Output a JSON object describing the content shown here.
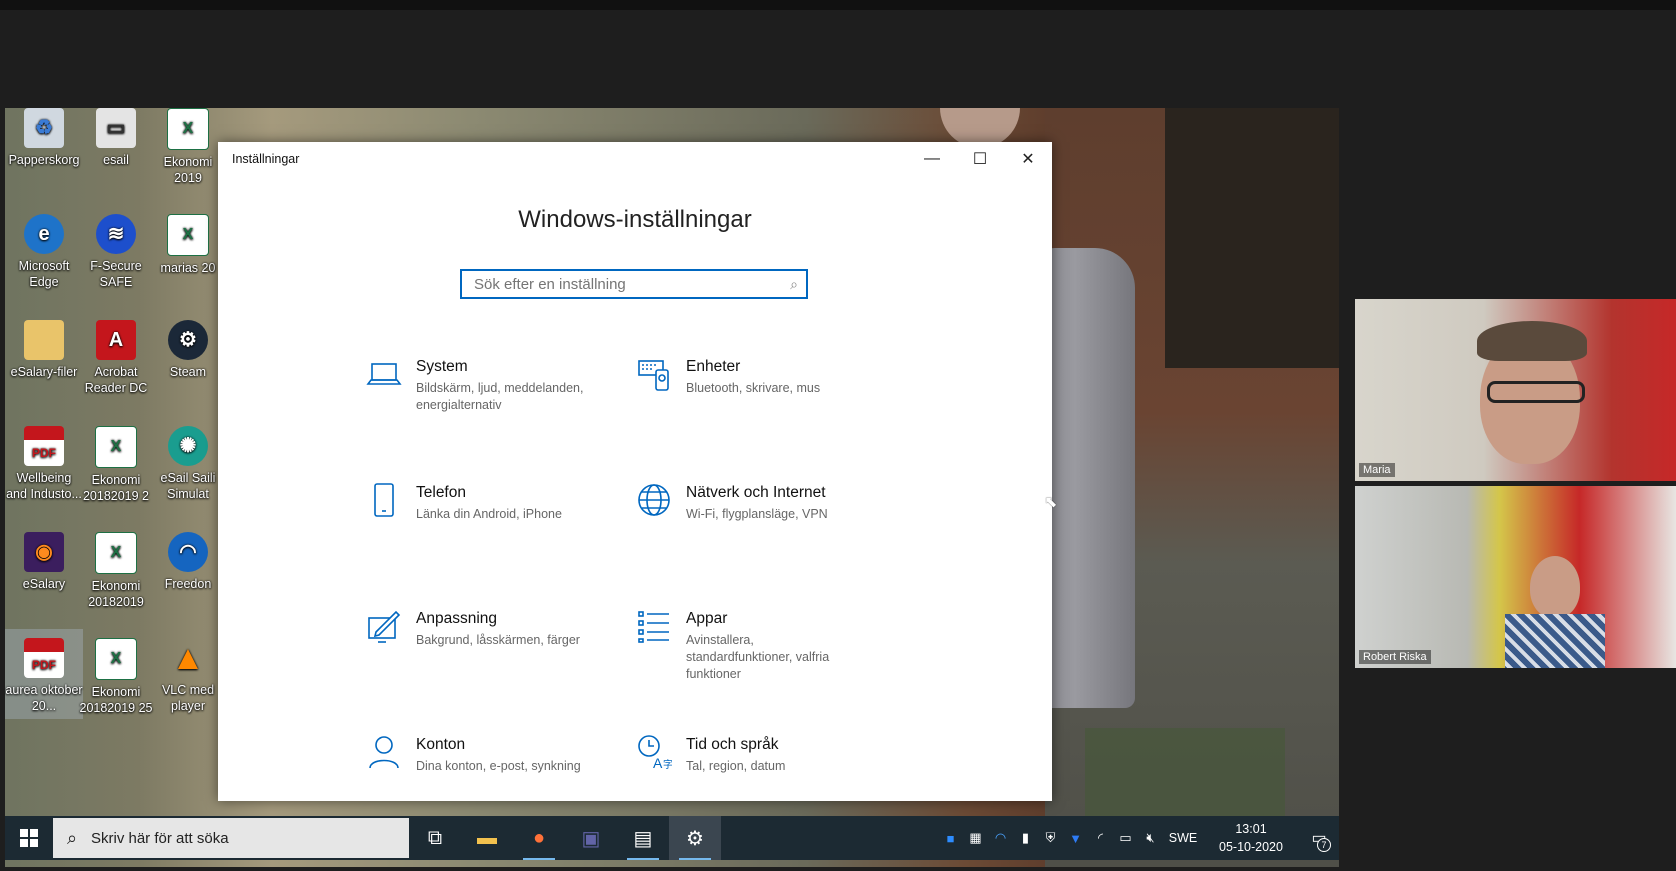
{
  "desktop_icons": [
    {
      "name": "recycle-bin-icon",
      "label": "Papperskorg",
      "glyph": "♻",
      "cls": "g-bin"
    },
    {
      "name": "esail-shortcut-icon",
      "label": "esail",
      "glyph": "▭",
      "cls": "g-pc"
    },
    {
      "name": "excel-file-icon",
      "label": "Ekonomi 2019",
      "glyph": "X",
      "cls": "g-xls"
    },
    {
      "name": "edge-icon",
      "label": "Microsoft Edge",
      "glyph": "e",
      "cls": "g-edge"
    },
    {
      "name": "fsecure-icon",
      "label": "F-Secure SAFE",
      "glyph": "≋",
      "cls": "g-fsec"
    },
    {
      "name": "excel-file-icon",
      "label": "marias 20",
      "glyph": "X",
      "cls": "g-xls"
    },
    {
      "name": "folder-icon",
      "label": "eSalary-filer",
      "glyph": "",
      "cls": "g-folder"
    },
    {
      "name": "acrobat-icon",
      "label": "Acrobat Reader DC",
      "glyph": "A",
      "cls": "g-acro"
    },
    {
      "name": "steam-icon",
      "label": "Steam",
      "glyph": "⚙",
      "cls": "g-steam"
    },
    {
      "name": "pdf-file-icon",
      "label": "Wellbeing and Industo...",
      "glyph": "PDF",
      "cls": "g-pdf"
    },
    {
      "name": "excel-file-icon",
      "label": "Ekonomi 20182019 2",
      "glyph": "X",
      "cls": "g-xls"
    },
    {
      "name": "esail-simulator-icon",
      "label": "eSail Saili Simulat",
      "glyph": "✺",
      "cls": "g-esail"
    },
    {
      "name": "firefox-icon",
      "label": "eSalary",
      "glyph": "◉",
      "cls": "g-firefox"
    },
    {
      "name": "excel-file-icon",
      "label": "Ekonomi 20182019",
      "glyph": "X",
      "cls": "g-xls"
    },
    {
      "name": "freedom-icon",
      "label": "Freedon",
      "glyph": "◠",
      "cls": "g-freedom"
    },
    {
      "name": "pdf-file-icon",
      "label": "aurea oktober 20...",
      "glyph": "PDF",
      "cls": "g-pdf"
    },
    {
      "name": "excel-file-icon",
      "label": "Ekonomi 20182019 25",
      "glyph": "X",
      "cls": "g-xls"
    },
    {
      "name": "vlc-icon",
      "label": "VLC med player",
      "glyph": "▲",
      "cls": "g-vlc"
    }
  ],
  "settings": {
    "window_title": "Inställningar",
    "minimize": "—",
    "maximize": "☐",
    "close": "✕",
    "heading": "Windows-inställningar",
    "search_placeholder": "Sök efter en inställning",
    "categories": [
      {
        "name": "System",
        "desc": "Bildskärm, ljud, meddelanden, energialternativ",
        "icon": "laptop-icon"
      },
      {
        "name": "Enheter",
        "desc": "Bluetooth, skrivare, mus",
        "icon": "devices-icon"
      },
      {
        "name": "Telefon",
        "desc": "Länka din Android, iPhone",
        "icon": "phone-icon"
      },
      {
        "name": "Nätverk och Internet",
        "desc": "Wi-Fi, flygplansläge, VPN",
        "icon": "globe-icon"
      },
      {
        "name": "Anpassning",
        "desc": "Bakgrund, låsskärmen, färger",
        "icon": "personalization-icon"
      },
      {
        "name": "Appar",
        "desc": "Avinstallera, standardfunktioner, valfria funktioner",
        "icon": "apps-icon"
      },
      {
        "name": "Konton",
        "desc": "Dina konton, e-post, synkning",
        "icon": "account-icon"
      },
      {
        "name": "Tid och språk",
        "desc": "Tal, region, datum",
        "icon": "time-language-icon"
      }
    ]
  },
  "participants": [
    {
      "name": "Maria"
    },
    {
      "name": "Robert Riska"
    }
  ],
  "taskbar": {
    "search_placeholder": "Skriv här för att söka",
    "language": "SWE",
    "time": "13:01",
    "date": "05-10-2020",
    "notification_count": "7"
  },
  "colors": {
    "accent": "#0067c0",
    "taskbar": "#1c2a33"
  }
}
